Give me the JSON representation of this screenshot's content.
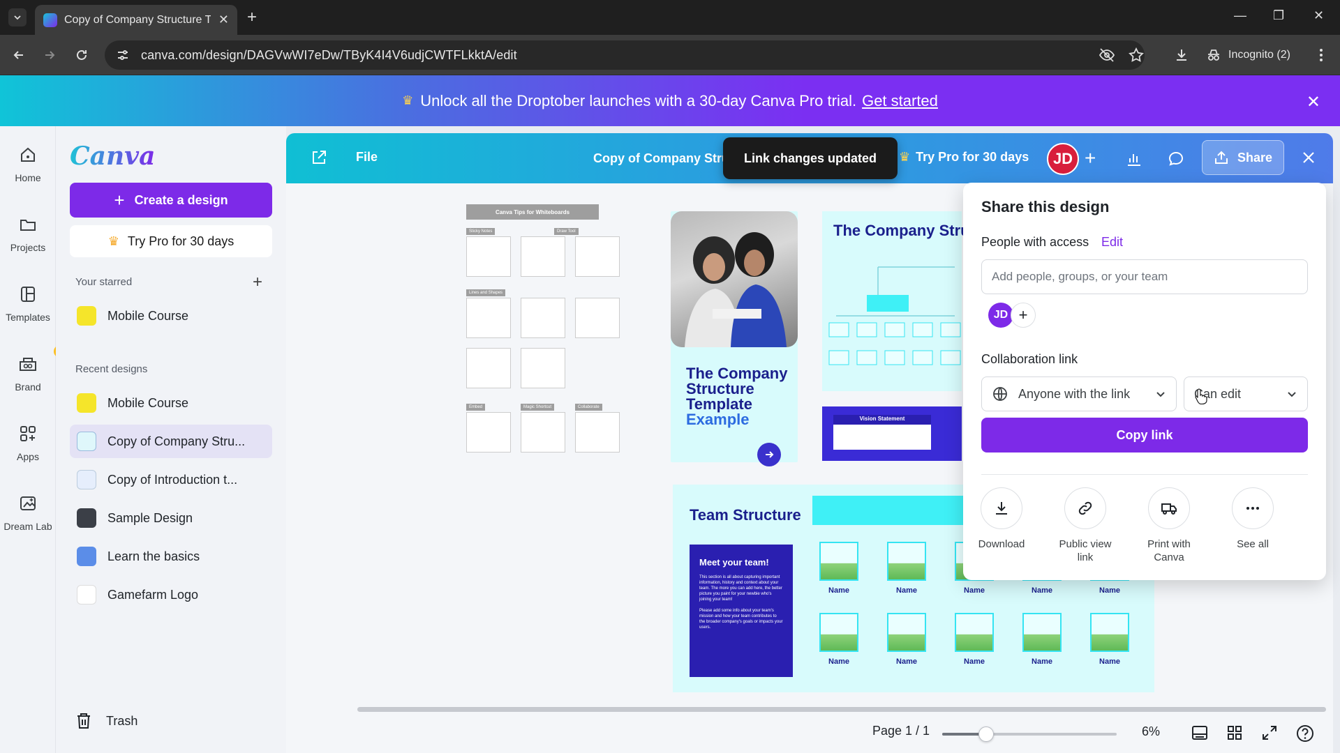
{
  "browser": {
    "tab_title": "Copy of Company Structure Te",
    "url": "canva.com/design/DAGVwWI7eDw/TByK4I4V6udjCWTFLkktA/edit",
    "incognito_label": "Incognito (2)"
  },
  "promo": {
    "text": "Unlock all the Droptober launches with a 30-day Canva Pro trial.",
    "link": "Get started"
  },
  "rail": {
    "home": "Home",
    "projects": "Projects",
    "templates": "Templates",
    "brand": "Brand",
    "apps": "Apps",
    "dream_lab": "Dream Lab"
  },
  "panel": {
    "logo": "Canva",
    "create_label": "Create a design",
    "try_pro_label": "Try Pro for 30 days",
    "starred_label": "Your starred",
    "starred": [
      {
        "label": "Mobile Course",
        "color": "#f5e52a"
      }
    ],
    "recent_label": "Recent designs",
    "recent": [
      {
        "label": "Mobile Course",
        "color": "#f5e52a"
      },
      {
        "label": "Copy of Company Stru...",
        "color": "#dff7fb"
      },
      {
        "label": "Copy of Introduction t...",
        "color": "#e6eefc"
      },
      {
        "label": "Sample Design",
        "color": "#3b3f47"
      },
      {
        "label": "Learn the basics",
        "color": "#5b8de8"
      },
      {
        "label": "Gamefarm Logo",
        "color": "#ffffff"
      }
    ],
    "trash_label": "Trash"
  },
  "editor": {
    "file_label": "File",
    "doc_title": "Copy of Company Stru",
    "toast": "Link changes updated",
    "try_pro_label": "Try Pro for 30 days",
    "avatar_initials": "JD",
    "share_label": "Share",
    "page_indicator": "Page 1 / 1",
    "zoom_value": "6%",
    "zoom_fraction": 0.06
  },
  "canvas": {
    "whiteboard_title": "Canva Tips for Whiteboards",
    "whiteboard_tags": [
      "Sticky Notes",
      "Draw Tool",
      "Lines and Shapes",
      "Embed",
      "Magic Shortcut",
      "Collaborate"
    ],
    "card_a_title": "The Company Structure Template",
    "card_a_example": "Example",
    "card_b_title": "The Company Structure Templa",
    "vision_label": "Vision Statement",
    "team_title": "Team Structure",
    "meet_title": "Meet your team!",
    "meet_p1": "This section is all about capturing important information, history and context about your team. The more you can add here, the better picture you paint for your newbie who's joining your team!",
    "meet_p2": "Please add some info about your team's mission and how your team contributes to the broader company's goals or impacts your users.",
    "name_label": "Name"
  },
  "share_panel": {
    "title": "Share this design",
    "people_label": "People with access",
    "edit_label": "Edit",
    "input_placeholder": "Add people, groups, or your team",
    "avatar_initials": "JD",
    "collab_label": "Collaboration link",
    "link_access": "Anyone with the link",
    "permission": "Can edit",
    "copy_label": "Copy link",
    "actions": [
      {
        "label": "Download"
      },
      {
        "label": "Public view link"
      },
      {
        "label": "Print with Canva"
      },
      {
        "label": "See all"
      }
    ]
  }
}
